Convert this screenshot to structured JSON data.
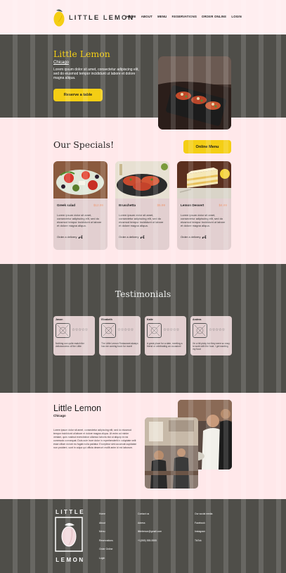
{
  "brand": {
    "name": "LITTLE LEMON",
    "footer_top": "LITTLE",
    "footer_bottom": "LEMON",
    "colors": {
      "primary_dark": "#4f4e49",
      "accent_yellow": "#f4ce14",
      "price_salmon": "#ee9972",
      "page_bg": "#ffe8ea"
    }
  },
  "nav": {
    "items": [
      {
        "label": "HOME"
      },
      {
        "label": "ABOUT"
      },
      {
        "label": "MENU"
      },
      {
        "label": "RESERVATIONS"
      },
      {
        "label": "ORDER ONLINE"
      },
      {
        "label": "LOGIN"
      }
    ]
  },
  "hero": {
    "title": "Little Lemon",
    "subtitle": "Chicago",
    "description": "Lorem ipsum dolor sit amet, consectetur adipiscing elit, sed do eiusmod tempor incididunt ut labore et dolore magna aliqua.",
    "cta": "Reserve a table"
  },
  "specials": {
    "title": "Our Specials!",
    "cta": "Online Menu",
    "delivery_icon": "scooter-icon",
    "cards": [
      {
        "name": "Greek salad",
        "price": "$12.99",
        "description": "Lorem ipsum dolor sit amet, consectetur adipiscing elit, sed do eiusmod tempor incididunt ut labore et dolore magna aliqua.",
        "delivery": "Order a delivery"
      },
      {
        "name": "Bruschetta",
        "price": "$5.99",
        "description": "Lorem ipsum dolor sit amet, consectetur adipiscing elit, sed do eiusmod tempor incididunt ut labore et dolore magna aliqua.",
        "delivery": "Order a delivery"
      },
      {
        "name": "Lemon Dessert",
        "price": "$4.99",
        "description": "Lorem ipsum dolor sit amet, consectetur adipiscing elit, sed do eiusmod tempor incididunt ut labore et dolore magna aliqua.",
        "delivery": "Order a delivery"
      }
    ]
  },
  "testimonials": {
    "title": "Testimonials",
    "items": [
      {
        "name": "Jason",
        "rating": "☆☆☆☆☆",
        "text": "Nothing can quite match the deliciousness of the Little"
      },
      {
        "name": "Elizabeth",
        "rating": "☆☆☆☆☆",
        "text": "The Little Lemon Restaurant always has me coming back for more!"
      },
      {
        "name": "Katie",
        "rating": "☆☆☆☆☆",
        "text": "A great place for a date, meeting a friend or celebrating an occasion!"
      },
      {
        "name": "Andrea",
        "rating": "☆☆☆☆☆",
        "text": "I'm a bit picky but they were so easy to work with the food. I get wanting my food"
      }
    ]
  },
  "about": {
    "title": "Little Lemon",
    "subtitle": "Chicago",
    "text": "Lorem ipsum dolor sit amet, consectetur adipiscing elit, sed do eiusmod tempor incididunt ut labore et dolore magna aliqua. Ut enim ad minim veniam, quis nostrud exercitation ullamco laboris nisi ut aliquip ex ea commodo consequat. Duis aute irure dolor in reprehenderit in voluptate velit esse cillum dolore eu fugiat nulla pariatur. Excepteur sint occaecat cupidatat non proident, sunt in culpa qui officia deserunt mollit anim id est laborum."
  },
  "footer": {
    "nav": [
      "Home",
      "About",
      "Menu",
      "Reservations",
      "Order Online",
      "Login"
    ],
    "contact": [
      "Contact us",
      "Adress",
      "littlelemon@gmail.com",
      "+1(555) 555-5555"
    ],
    "social": [
      "Our social media",
      "Facebook",
      "Instagram",
      "TikTok"
    ]
  }
}
